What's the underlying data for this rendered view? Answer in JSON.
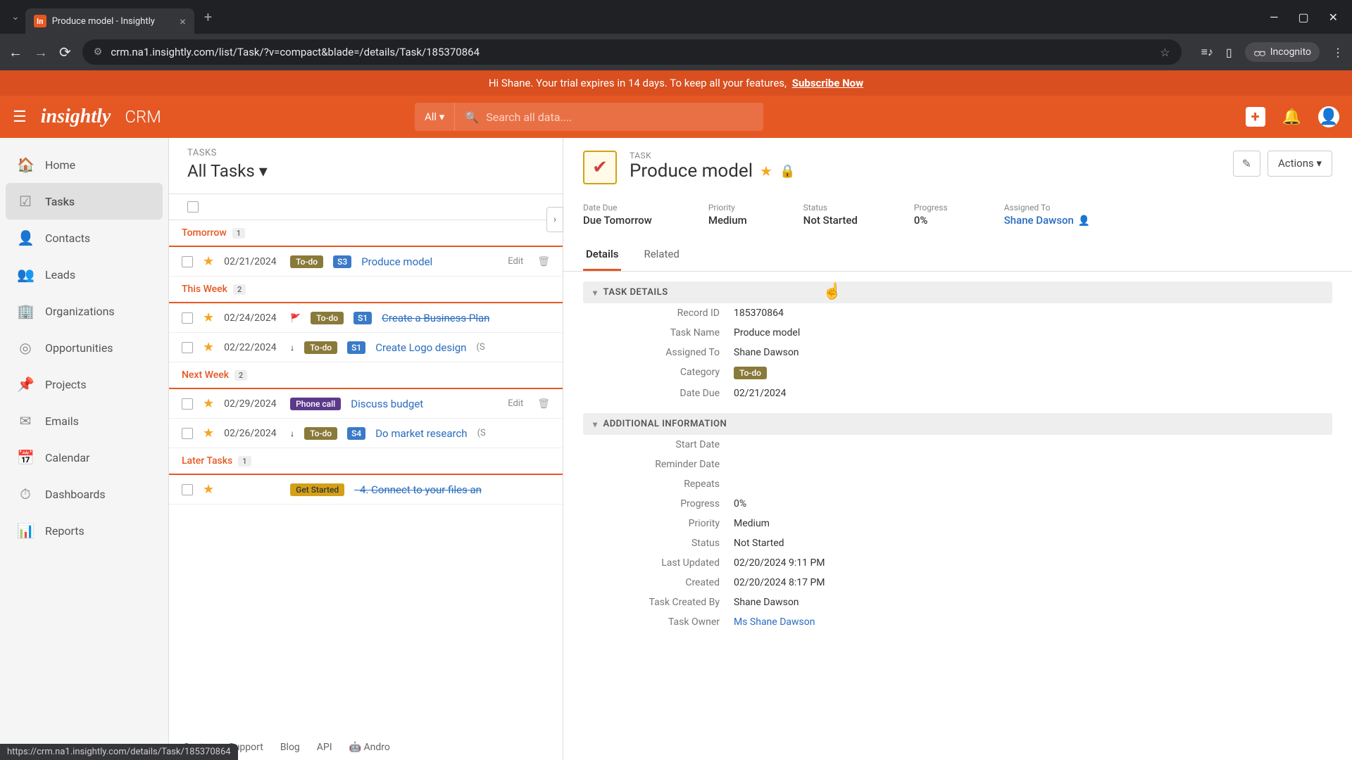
{
  "browser": {
    "tab_title": "Produce model - Insightly",
    "url": "crm.na1.insightly.com/list/Task/?v=compact&blade=/details/Task/185370864",
    "incognito": "Incognito",
    "status_bar": "https://crm.na1.insightly.com/details/Task/185370864"
  },
  "trial_banner": {
    "text": "Hi Shane. Your trial expires in 14 days. To keep all your features,",
    "cta": "Subscribe Now"
  },
  "header": {
    "logo": "insightly",
    "app": "CRM",
    "search_scope": "All ▾",
    "search_placeholder": "Search all data...."
  },
  "sidebar": {
    "items": [
      {
        "label": "Home",
        "icon": "🏠"
      },
      {
        "label": "Tasks",
        "icon": "☑"
      },
      {
        "label": "Contacts",
        "icon": "👤"
      },
      {
        "label": "Leads",
        "icon": "👥"
      },
      {
        "label": "Organizations",
        "icon": "🏢"
      },
      {
        "label": "Opportunities",
        "icon": "◎"
      },
      {
        "label": "Projects",
        "icon": "📌"
      },
      {
        "label": "Emails",
        "icon": "✉"
      },
      {
        "label": "Calendar",
        "icon": "📅"
      },
      {
        "label": "Dashboards",
        "icon": "⏱"
      },
      {
        "label": "Reports",
        "icon": "📊"
      }
    ]
  },
  "task_list": {
    "label": "TASKS",
    "title": "All Tasks ▾",
    "groups": [
      {
        "name": "Tomorrow",
        "count": "1",
        "tasks": [
          {
            "date": "02/21/2024",
            "badge": "To-do",
            "stage": "S3",
            "name": "Produce model",
            "edit": "Edit"
          }
        ]
      },
      {
        "name": "This Week",
        "count": "2",
        "tasks": [
          {
            "date": "02/24/2024",
            "prio": "🚩",
            "badge": "To-do",
            "stage": "S1",
            "name": "Create a Business Plan",
            "strike": true
          },
          {
            "date": "02/22/2024",
            "prio": "↓",
            "badge": "To-do",
            "stage": "S1",
            "name": "Create Logo design",
            "extra": "(S"
          }
        ]
      },
      {
        "name": "Next Week",
        "count": "2",
        "tasks": [
          {
            "date": "02/29/2024",
            "badge": "Phone call",
            "badgeClass": "phone",
            "name": "Discuss budget",
            "edit": "Edit"
          },
          {
            "date": "02/26/2024",
            "prio": "↓",
            "badge": "To-do",
            "stage": "S4",
            "name": "Do market research",
            "extra": "(S"
          }
        ]
      },
      {
        "name": "Later Tasks",
        "count": "1",
        "tasks": [
          {
            "date": "",
            "badge": "Get Started",
            "badgeClass": "started",
            "name": "4. Connect to your files an",
            "strike": true,
            "dash": true
          }
        ]
      }
    ]
  },
  "detail": {
    "type": "TASK",
    "title": "Produce model",
    "actions_label": "Actions ▾",
    "summary": [
      {
        "label": "Date Due",
        "value": "Due Tomorrow"
      },
      {
        "label": "Priority",
        "value": "Medium"
      },
      {
        "label": "Status",
        "value": "Not Started"
      },
      {
        "label": "Progress",
        "value": "0%"
      },
      {
        "label": "Assigned To",
        "value": "Shane Dawson",
        "link": true
      }
    ],
    "tabs": {
      "details": "Details",
      "related": "Related"
    },
    "sections": {
      "task_details": {
        "title": "TASK DETAILS",
        "fields": [
          {
            "label": "Record ID",
            "value": "185370864"
          },
          {
            "label": "Task Name",
            "value": "Produce model"
          },
          {
            "label": "Assigned To",
            "value": "Shane Dawson"
          },
          {
            "label": "Category",
            "value": "To-do",
            "badge": true
          },
          {
            "label": "Date Due",
            "value": "02/21/2024"
          }
        ]
      },
      "additional": {
        "title": "ADDITIONAL INFORMATION",
        "fields": [
          {
            "label": "Start Date",
            "value": ""
          },
          {
            "label": "Reminder Date",
            "value": ""
          },
          {
            "label": "Repeats",
            "value": ""
          },
          {
            "label": "Progress",
            "value": "0%"
          },
          {
            "label": "Priority",
            "value": "Medium"
          },
          {
            "label": "Status",
            "value": "Not Started"
          },
          {
            "label": "Last Updated",
            "value": "02/20/2024 9:11 PM"
          },
          {
            "label": "Created",
            "value": "02/20/2024 8:17 PM"
          },
          {
            "label": "Task Created By",
            "value": "Shane Dawson"
          },
          {
            "label": "Task Owner",
            "value": "Ms Shane Dawson",
            "link": true
          }
        ]
      }
    }
  },
  "footer": {
    "links": [
      "Customer Support",
      "Blog",
      "API",
      "Andro"
    ]
  }
}
